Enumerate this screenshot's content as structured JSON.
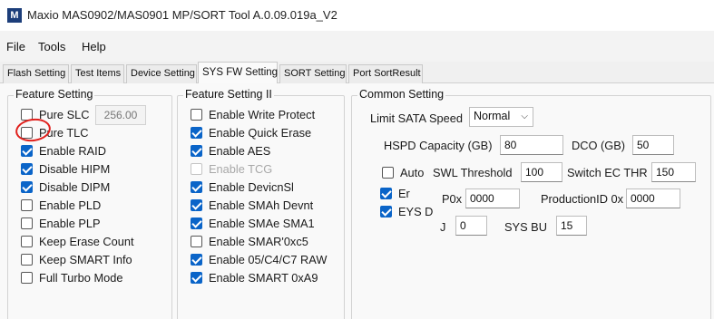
{
  "window": {
    "title": "Maxio MAS0902/MAS0901 MP/SORT Tool A.0.09.019a_V2",
    "icon_letter": "M"
  },
  "menu": [
    "File",
    "Tools",
    "Help"
  ],
  "tabs": [
    "Flash Setting",
    "Test Items",
    "Device Setting",
    "SYS FW Setting",
    "SORT Setting",
    "Port SortResult"
  ],
  "active_tab": "SYS FW Setting",
  "feature_setting": {
    "title": "Feature Setting",
    "items": [
      {
        "label": "Pure SLC",
        "checked": false,
        "value": "256.00"
      },
      {
        "label": "Pure TLC",
        "checked": false
      },
      {
        "label": "Enable RAID",
        "checked": true
      },
      {
        "label": "Disable HIPM",
        "checked": true
      },
      {
        "label": "Disable DIPM",
        "checked": true
      },
      {
        "label": "Enable PLD",
        "checked": false
      },
      {
        "label": "Enable PLP",
        "checked": false
      },
      {
        "label": "Keep Erase Count",
        "checked": false
      },
      {
        "label": "Keep SMART Info",
        "checked": false
      },
      {
        "label": "Full Turbo Mode",
        "checked": false
      }
    ]
  },
  "feature_setting_2": {
    "title": "Feature Setting II",
    "items": [
      {
        "label": "Enable Write Protect",
        "checked": false
      },
      {
        "label": "Enable Quick Erase",
        "checked": true
      },
      {
        "label": "Enable AES",
        "checked": true
      },
      {
        "label": "Enable TCG",
        "checked": false,
        "disabled": true
      },
      {
        "label": "Enable DevicnSl",
        "checked": true
      },
      {
        "label": "Enable SMAh Devnt",
        "checked": true
      },
      {
        "label": "Enable SMAe SMA1",
        "checked": true
      },
      {
        "label": "Enable SMAR'0xc5",
        "checked": false
      },
      {
        "label": "Enable 05/C4/C7 RAW",
        "checked": true
      },
      {
        "label": "Enable SMART 0xA9",
        "checked": true
      }
    ]
  },
  "common_setting": {
    "title": "Common Setting",
    "limit_sata_speed": {
      "label": "Limit SATA Speed",
      "value": "Normal"
    },
    "hspd_capacity": {
      "label": "HSPD Capacity (GB)",
      "value": "80"
    },
    "dco": {
      "label": "DCO (GB)",
      "value": "50"
    },
    "auto": {
      "label": "Auto",
      "checked": false
    },
    "swl_threshold": {
      "label": "SWL Threshold",
      "value": "100"
    },
    "switch_ec_thr": {
      "label": "Switch EC THR",
      "value": "150"
    },
    "row4_check": {
      "label": "Er",
      "checked": true
    },
    "p0x": {
      "label": "P0x",
      "value": "0000"
    },
    "production_id": {
      "label": "ProductionID 0x",
      "value": "0000"
    },
    "row5_check": {
      "label": "EYS D",
      "checked": true
    },
    "j_field": {
      "label": "J",
      "value": "0"
    },
    "sys_bu": {
      "label": "SYS BU",
      "value": "15"
    }
  }
}
